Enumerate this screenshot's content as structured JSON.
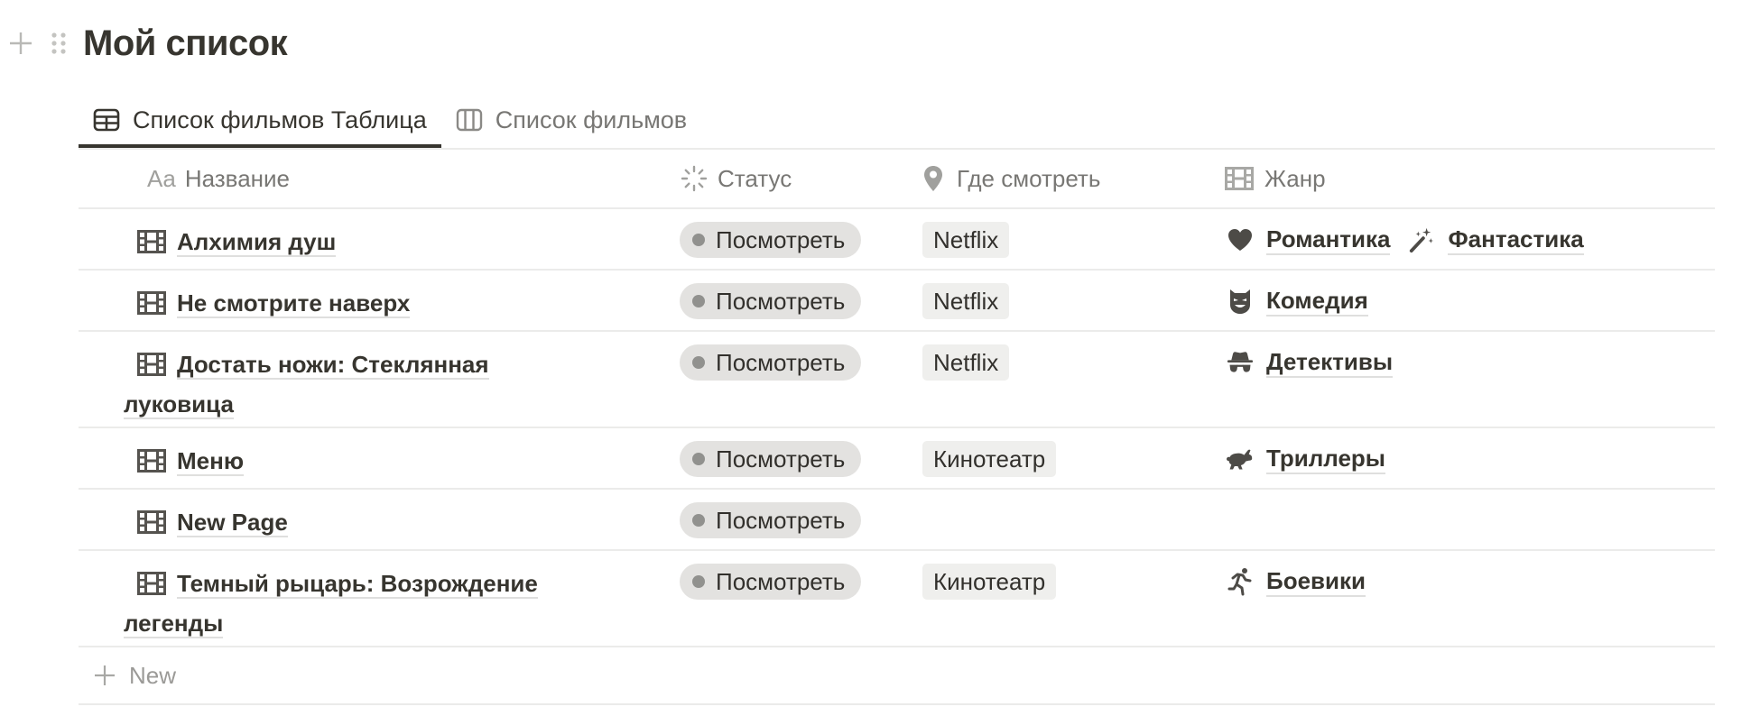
{
  "page": {
    "title": "Мой список"
  },
  "tabs": [
    {
      "label": "Список фильмов Таблица",
      "icon": "table-icon",
      "active": true
    },
    {
      "label": "Список фильмов",
      "icon": "board-icon",
      "active": false
    }
  ],
  "columns": {
    "name": {
      "prefix": "Aa",
      "label": "Название"
    },
    "status": {
      "label": "Статус",
      "icon": "status-icon"
    },
    "where": {
      "label": "Где смотреть",
      "icon": "location-pin-icon"
    },
    "genre": {
      "label": "Жанр",
      "icon": "film-icon"
    }
  },
  "rows": [
    {
      "name_line1": "Алхимия душ",
      "name_line2": "",
      "status": "Посмотреть",
      "where": "Netflix",
      "genres": [
        {
          "label": "Романтика",
          "icon": "heart-icon"
        },
        {
          "label": "Фантастика",
          "icon": "magic-wand-icon"
        }
      ]
    },
    {
      "name_line1": "Не смотрите наверх",
      "name_line2": "",
      "status": "Посмотреть",
      "where": "Netflix",
      "genres": [
        {
          "label": "Комедия",
          "icon": "mask-icon"
        }
      ]
    },
    {
      "name_line1": "Достать ножи: Стеклянная",
      "name_line2": "луковица",
      "status": "Посмотреть",
      "where": "Netflix",
      "genres": [
        {
          "label": "Детективы",
          "icon": "detective-icon"
        }
      ]
    },
    {
      "name_line1": "Меню",
      "name_line2": "",
      "status": "Посмотреть",
      "where": "Кинотеатр",
      "genres": [
        {
          "label": "Триллеры",
          "icon": "rabbit-icon"
        }
      ]
    },
    {
      "name_line1": "New Page",
      "name_line2": "",
      "status": "Посмотреть",
      "where": "",
      "genres": []
    },
    {
      "name_line1": "Темный рыцарь: Возрождение",
      "name_line2": "легенды",
      "status": "Посмотреть",
      "where": "Кинотеатр",
      "genres": [
        {
          "label": "Боевики",
          "icon": "running-person-icon"
        }
      ]
    }
  ],
  "new_row": {
    "label": "New"
  },
  "colors": {
    "text": "#37352f",
    "muted": "#787774",
    "status_pill_bg": "#e3e2e0",
    "status_dot": "#91918e",
    "tag_bg": "#efefed",
    "divider": "#ebebea"
  }
}
